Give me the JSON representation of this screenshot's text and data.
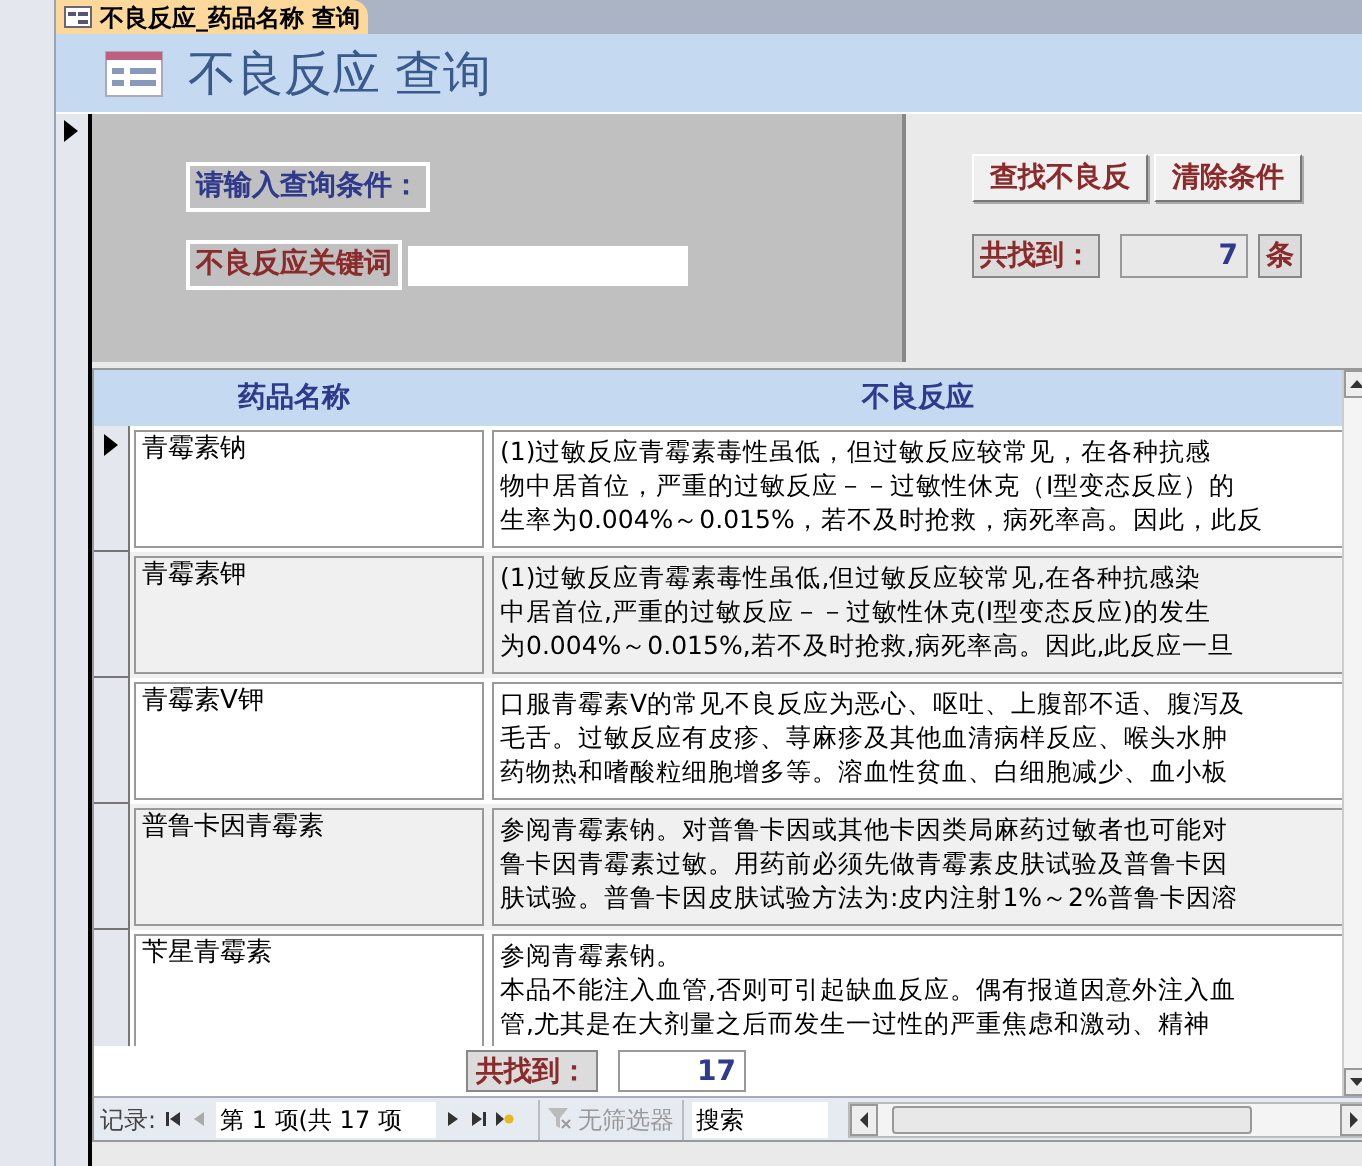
{
  "tab": {
    "title": "不良反应_药品名称 查询",
    "selected": true
  },
  "header": {
    "title": "不良反应 查询"
  },
  "search_panel": {
    "prompt": "请输入查询条件：",
    "keyword_label": "不良反应关键词"
  },
  "buttons": [
    "查找不良反",
    "清除条件"
  ],
  "summary": {
    "label": "共找到：",
    "count": "7",
    "unit": "条"
  },
  "table": {
    "columns": [
      "药品名称",
      "不良反应"
    ],
    "rows": [
      {
        "name": "青霉素钠",
        "selected": true,
        "lines": [
          "(1)过敏反应青霉素毒性虽低，但过敏反应较常见，在各种抗感",
          "物中居首位，严重的过敏反应－－过敏性休克（Ⅰ型变态反应）的",
          "生率为0.004%～0.015%，若不及时抢救，病死率高。因此，此反"
        ]
      },
      {
        "name": "青霉素钾",
        "selected": false,
        "lines": [
          "(1)过敏反应青霉素毒性虽低,但过敏反应较常见,在各种抗感染",
          "中居首位,严重的过敏反应－－过敏性休克(Ⅰ型变态反应)的发生",
          "为0.004%～0.015%,若不及时抢救,病死率高。因此,此反应一旦"
        ]
      },
      {
        "name": "青霉素V钾",
        "selected": false,
        "lines": [
          "口服青霉素V的常见不良反应为恶心、呕吐、上腹部不适、腹泻及",
          "毛舌。过敏反应有皮疹、荨麻疹及其他血清病样反应、喉头水肿",
          "药物热和嗜酸粒细胞增多等。溶血性贫血、白细胞减少、血小板"
        ]
      },
      {
        "name": "普鲁卡因青霉素",
        "selected": false,
        "lines": [
          "参阅青霉素钠。对普鲁卡因或其他卡因类局麻药过敏者也可能对",
          "鲁卡因青霉素过敏。用药前必须先做青霉素皮肤试验及普鲁卡因",
          "肤试验。普鲁卡因皮肤试验方法为:皮内注射1%～2%普鲁卡因溶"
        ]
      },
      {
        "name": "苄星青霉素",
        "selected": false,
        "lines": [
          "参阅青霉素钠。",
          "本品不能注入血管,否则可引起缺血反应。偶有报道因意外注入血",
          "管,尤其是在大剂量之后而发生一过性的严重焦虑和激动、精神"
        ]
      }
    ]
  },
  "subform_footer": {
    "label": "共找到：",
    "count": "17"
  },
  "record_nav": {
    "label": "记录:",
    "position": "第 1 项(共 17 项",
    "filter": "无筛选器",
    "search_placeholder": "搜索"
  }
}
